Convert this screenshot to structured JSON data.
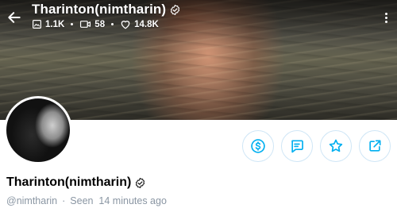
{
  "header": {
    "title": "Tharinton(nimtharin)",
    "stats": {
      "photos": "1.1K",
      "videos": "58",
      "likes": "14.8K"
    }
  },
  "profile": {
    "name": "Tharinton(nimtharin)",
    "handle": "@nimtharin",
    "last_seen": "Seen  14 minutes ago"
  },
  "colors": {
    "accent": "#00aff0",
    "muted_text": "#8a96a3"
  },
  "actions": [
    {
      "icon": "dollar-icon"
    },
    {
      "icon": "message-icon"
    },
    {
      "icon": "star-icon"
    },
    {
      "icon": "share-icon"
    }
  ]
}
